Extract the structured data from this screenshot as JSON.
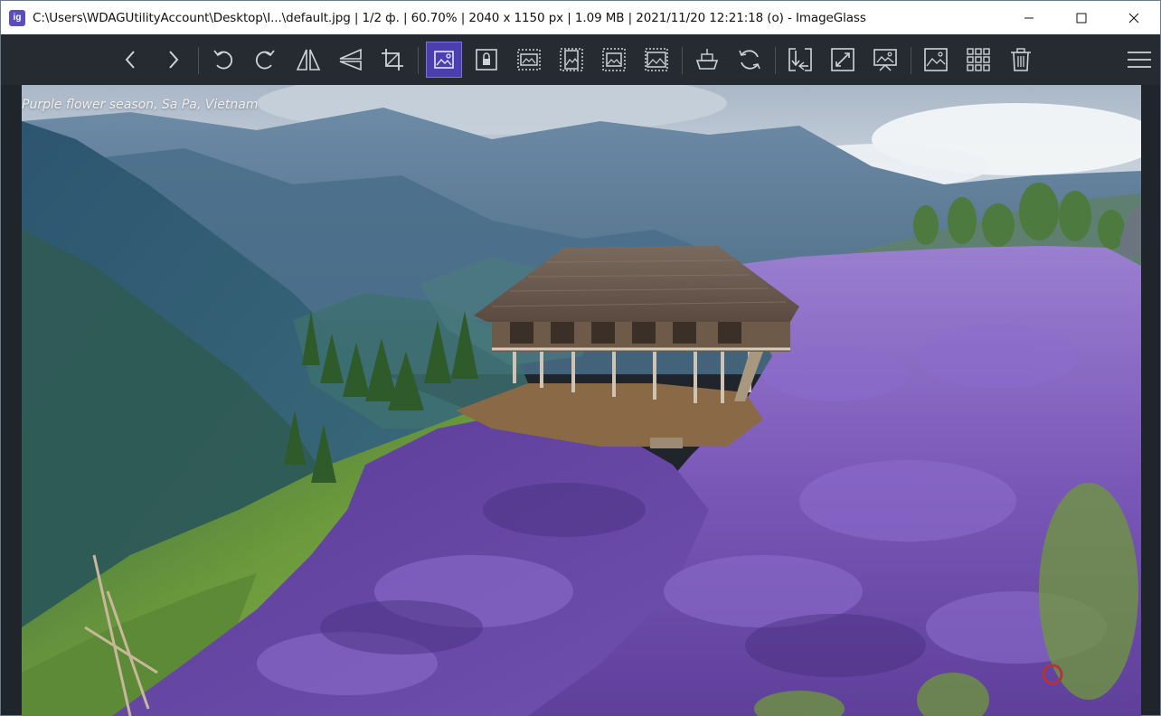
{
  "window": {
    "title": "C:\\Users\\WDAGUtilityAccount\\Desktop\\I...\\default.jpg  |  1/2 ф.  |  60.70%  |  2040 x 1150 px  |  1.09 MB  |  2021/11/20 12:21:18 (o)  - ImageGlass",
    "app_icon_glyph": "ig",
    "controls": {
      "minimize": "minimize-icon",
      "maximize": "maximize-icon",
      "close": "close-icon"
    }
  },
  "toolbar": {
    "accent_color": "#4b3fb0",
    "buttons": [
      {
        "id": "previous",
        "icon": "chevron-left-icon"
      },
      {
        "id": "next",
        "icon": "chevron-right-icon"
      },
      {
        "id": "rotate-left",
        "icon": "rotate-left-icon"
      },
      {
        "id": "rotate-right",
        "icon": "rotate-right-icon"
      },
      {
        "id": "flip-horizontal",
        "icon": "flip-horizontal-icon"
      },
      {
        "id": "flip-vertical",
        "icon": "flip-vertical-icon"
      },
      {
        "id": "crop",
        "icon": "crop-icon"
      },
      {
        "id": "auto-zoom",
        "icon": "auto-zoom-icon",
        "active": true
      },
      {
        "id": "lock-zoom",
        "icon": "lock-zoom-icon"
      },
      {
        "id": "scale-to-width",
        "icon": "scale-width-icon"
      },
      {
        "id": "scale-to-height",
        "icon": "scale-height-icon"
      },
      {
        "id": "scale-to-fit",
        "icon": "scale-fit-icon"
      },
      {
        "id": "scale-to-fill",
        "icon": "scale-fill-icon"
      },
      {
        "id": "open-with",
        "icon": "open-with-icon"
      },
      {
        "id": "refresh",
        "icon": "refresh-icon"
      },
      {
        "id": "goto-image",
        "icon": "goto-icon"
      },
      {
        "id": "fullscreen",
        "icon": "fullscreen-icon"
      },
      {
        "id": "slideshow",
        "icon": "slideshow-icon"
      },
      {
        "id": "thumbnail",
        "icon": "thumbnail-icon"
      },
      {
        "id": "checkerboard",
        "icon": "grid-icon"
      },
      {
        "id": "delete",
        "icon": "trash-icon"
      },
      {
        "id": "menu",
        "icon": "hamburger-menu-icon"
      }
    ]
  },
  "viewer": {
    "caption": "Purple flower season, Sa Pa, Vietnam",
    "background": "#1f252b"
  }
}
